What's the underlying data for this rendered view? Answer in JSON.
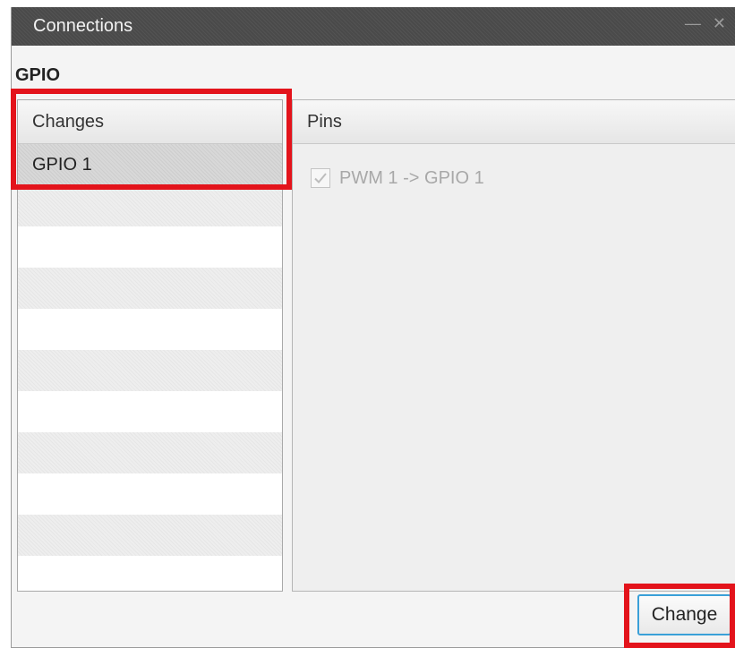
{
  "window": {
    "title": "Connections",
    "controls": "— ✕"
  },
  "section": {
    "label": "GPIO"
  },
  "changes_list": {
    "header": "Changes",
    "items": [
      "GPIO 1"
    ]
  },
  "pins_panel": {
    "header": "Pins",
    "items": [
      {
        "label": "PWM 1 -> GPIO 1",
        "checked": true,
        "enabled": false
      }
    ]
  },
  "footer": {
    "change_label": "Change"
  },
  "colors": {
    "highlight": "#e3131b",
    "titlebar": "#4a4a4a",
    "button_focus": "#3aa0d8"
  }
}
